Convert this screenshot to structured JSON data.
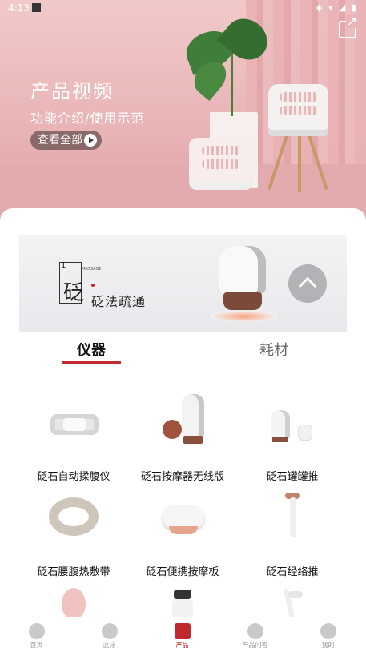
{
  "status_bar": {
    "time": "4:13",
    "icons": "◈ ▾ ◢ ▮"
  },
  "hero": {
    "title": "产品视频",
    "subtitle": "功能介绍/使用示范",
    "view_all": "查看全部"
  },
  "banner": {
    "logo_num": "1",
    "logo_char": "砭",
    "logo_en": "MASSAGE",
    "slogan": "砭法疏通"
  },
  "tabs": [
    {
      "label": "仪器",
      "active": true
    },
    {
      "label": "耗材",
      "active": false
    }
  ],
  "products": [
    {
      "name": "砭石自动揉腹仪"
    },
    {
      "name": "砭石按摩器无线版"
    },
    {
      "name": "砭石罐罐推"
    },
    {
      "name": "砭石腰腹热敷带"
    },
    {
      "name": "砭石便携按摩板"
    },
    {
      "name": "砭石经络推"
    }
  ],
  "nav": [
    {
      "label": "首页",
      "icon": "home-icon",
      "active": false
    },
    {
      "label": "蓝牙",
      "icon": "bluetooth-icon",
      "active": false
    },
    {
      "label": "产品",
      "icon": "product-bag-icon",
      "active": true
    },
    {
      "label": "产品问答",
      "icon": "qa-icon",
      "active": false
    },
    {
      "label": "我的",
      "icon": "profile-icon",
      "active": false
    }
  ],
  "colors": {
    "accent": "#c0282d",
    "hero_bg": "#e9b5b7"
  }
}
